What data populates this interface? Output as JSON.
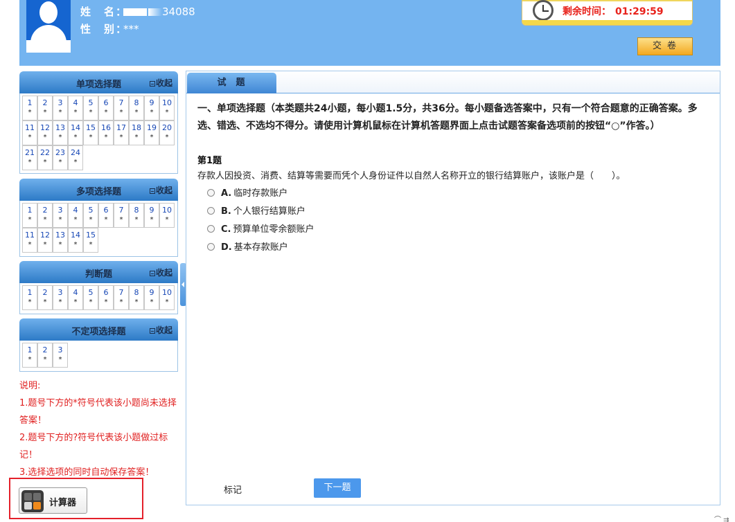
{
  "header": {
    "name_label": "姓　名：",
    "name_value": "34088",
    "gender_label": "性　别：",
    "gender_value": "***",
    "timer_label": "剩余时间：",
    "timer_value": "01:29:59",
    "submit_label": "交卷"
  },
  "sidebar": {
    "collapse_label": "收起",
    "sections": [
      {
        "title": "单项选择题",
        "items": [
          {
            "n": "1",
            "s": "*"
          },
          {
            "n": "2",
            "s": "*"
          },
          {
            "n": "3",
            "s": "*"
          },
          {
            "n": "4",
            "s": "*"
          },
          {
            "n": "5",
            "s": "*"
          },
          {
            "n": "6",
            "s": "*"
          },
          {
            "n": "7",
            "s": "*"
          },
          {
            "n": "8",
            "s": "*"
          },
          {
            "n": "9",
            "s": "*"
          },
          {
            "n": "10",
            "s": "*"
          },
          {
            "n": "11",
            "s": "*"
          },
          {
            "n": "12",
            "s": "*"
          },
          {
            "n": "13",
            "s": "*"
          },
          {
            "n": "14",
            "s": "*"
          },
          {
            "n": "15",
            "s": "*"
          },
          {
            "n": "16",
            "s": "*"
          },
          {
            "n": "17",
            "s": "*"
          },
          {
            "n": "18",
            "s": "*"
          },
          {
            "n": "19",
            "s": "*"
          },
          {
            "n": "20",
            "s": "*"
          },
          {
            "n": "21",
            "s": "*"
          },
          {
            "n": "22",
            "s": "*"
          },
          {
            "n": "23",
            "s": "*"
          },
          {
            "n": "24",
            "s": "*"
          }
        ]
      },
      {
        "title": "多项选择题",
        "items": [
          {
            "n": "1",
            "s": "*"
          },
          {
            "n": "2",
            "s": "*"
          },
          {
            "n": "3",
            "s": "*"
          },
          {
            "n": "4",
            "s": "*"
          },
          {
            "n": "5",
            "s": "*"
          },
          {
            "n": "6",
            "s": "*"
          },
          {
            "n": "7",
            "s": "*"
          },
          {
            "n": "8",
            "s": "*"
          },
          {
            "n": "9",
            "s": "*"
          },
          {
            "n": "10",
            "s": "*"
          },
          {
            "n": "11",
            "s": "*"
          },
          {
            "n": "12",
            "s": "*"
          },
          {
            "n": "13",
            "s": "*"
          },
          {
            "n": "14",
            "s": "*"
          },
          {
            "n": "15",
            "s": "*"
          }
        ]
      },
      {
        "title": "判断题",
        "items": [
          {
            "n": "1",
            "s": "*"
          },
          {
            "n": "2",
            "s": "*"
          },
          {
            "n": "3",
            "s": "*"
          },
          {
            "n": "4",
            "s": "*"
          },
          {
            "n": "5",
            "s": "*"
          },
          {
            "n": "6",
            "s": "*"
          },
          {
            "n": "7",
            "s": "*"
          },
          {
            "n": "8",
            "s": "*"
          },
          {
            "n": "9",
            "s": "*"
          },
          {
            "n": "10",
            "s": "*"
          }
        ]
      },
      {
        "title": "不定项选择题",
        "items": [
          {
            "n": "1",
            "s": "*"
          },
          {
            "n": "2",
            "s": "*"
          },
          {
            "n": "3",
            "s": "*"
          }
        ]
      }
    ],
    "notes": [
      "说明:",
      "1.题号下方的*符号代表该小题尚未选择答案！",
      "2.题号下方的?符号代表该小题做过标记！",
      "3.选择选项的同时自动保存答案！"
    ],
    "calculator_label": "计算器"
  },
  "main": {
    "tab_label": "试题",
    "section_text": "一、单项选择题（本类题共24小题，每小题1.5分，共36分。每小题备选答案中，只有一个符合题意的正确答案。多选、错选、不选均不得分。请使用计算机鼠标在计算机答题界面上点击试题答案备选项前的按钮“○”作答。）",
    "question_number": "第1题",
    "question_text": "存款人因投资、消费、结算等需要而凭个人身份证件以自然人名称开立的银行结算账户，该账户是（　　）。",
    "options": [
      {
        "letter": "A.",
        "text": "临时存款账户"
      },
      {
        "letter": "B.",
        "text": "个人银行结算账户"
      },
      {
        "letter": "C.",
        "text": "预算单位零余额账户"
      },
      {
        "letter": "D.",
        "text": "基本存款账户"
      }
    ],
    "mark_label": "标记",
    "next_label": "下一题"
  },
  "corner": {
    "glyph": "⌒ ⇉"
  }
}
